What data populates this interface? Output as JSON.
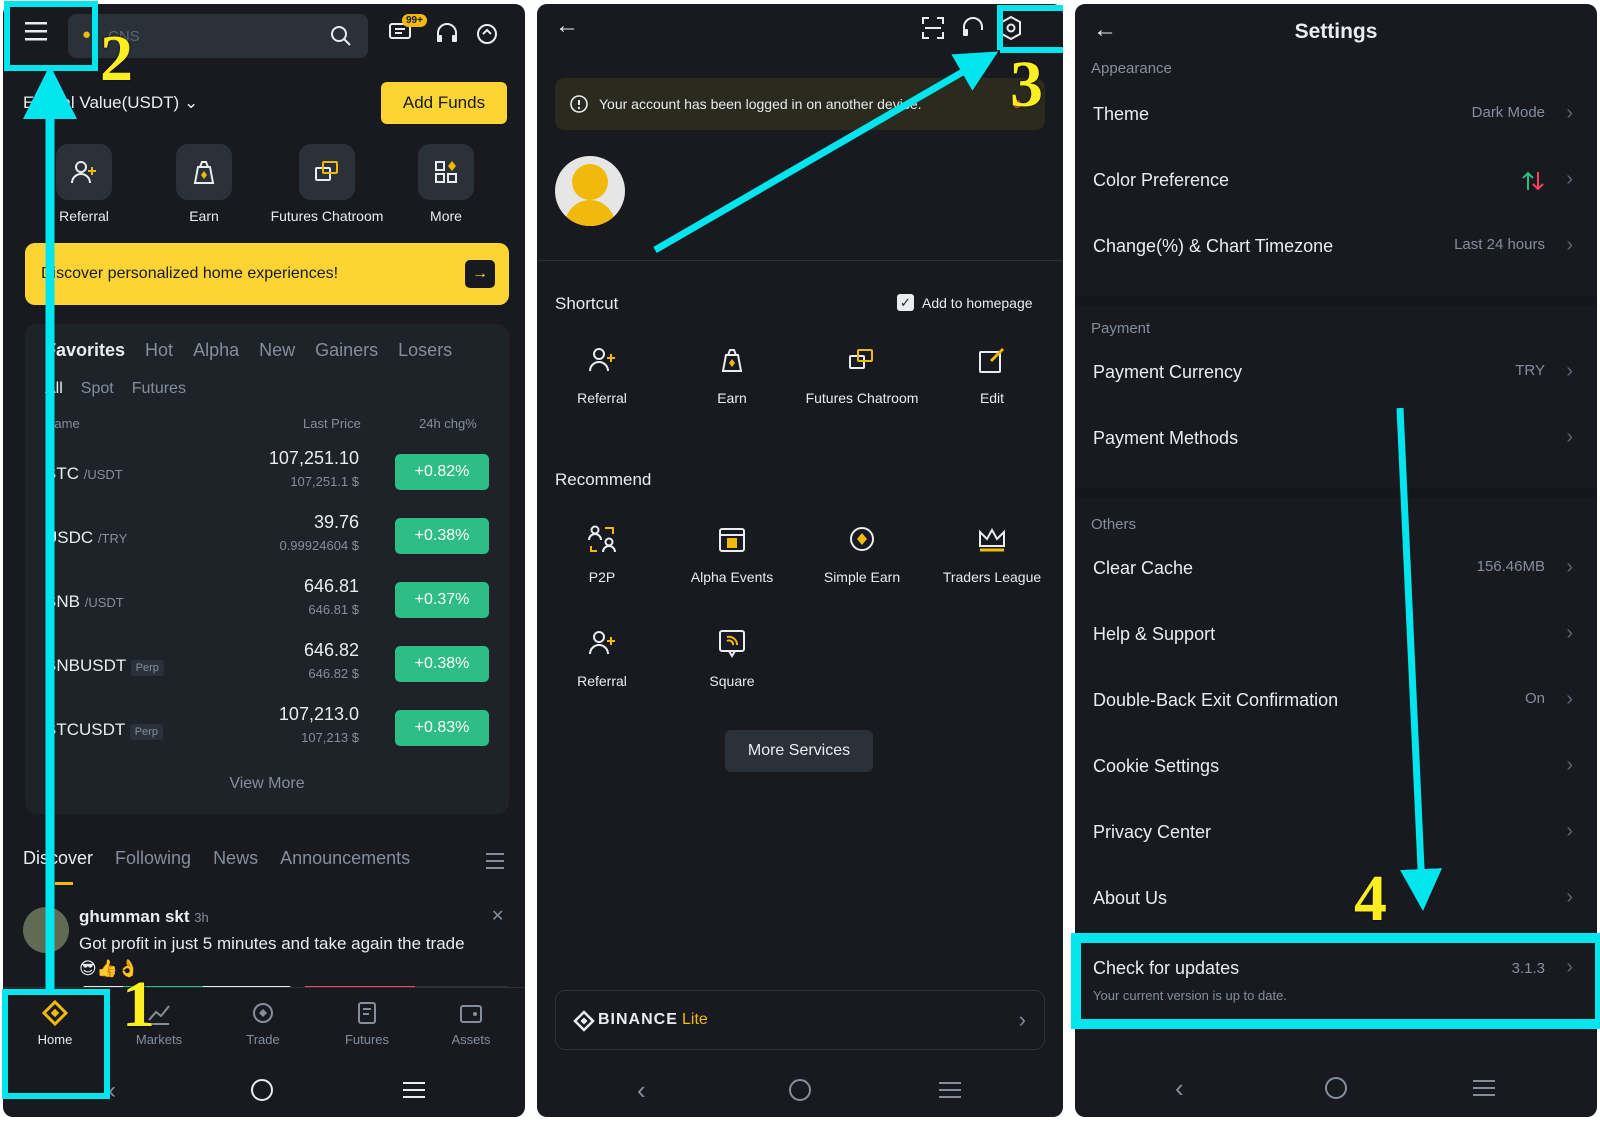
{
  "panel1": {
    "search_placeholder": "CNS",
    "notif_badge": "99+",
    "total_value_label": "Total Value(USDT)",
    "add_funds": "Add Funds",
    "quick_actions": [
      "Referral",
      "Earn",
      "Futures Chatroom",
      "More"
    ],
    "banner_text": "Discover personalized home experiences!",
    "market_tabs": [
      "Favorites",
      "Hot",
      "Alpha",
      "New",
      "Gainers",
      "Losers"
    ],
    "sub_tabs": [
      "All",
      "Spot",
      "Futures"
    ],
    "col_name": "Name",
    "col_last_price": "Last Price",
    "col_chg": "24h chg%",
    "rows": [
      {
        "symbol": "BTC",
        "quote": "/USDT",
        "price": "107,251.10",
        "sub": "107,251.1 $",
        "chg": "+0.82%"
      },
      {
        "symbol": "USDC",
        "quote": "/TRY",
        "price": "39.76",
        "sub": "0.99924604 $",
        "chg": "+0.38%"
      },
      {
        "symbol": "BNB",
        "quote": "/USDT",
        "price": "646.81",
        "sub": "646.81 $",
        "chg": "+0.37%"
      },
      {
        "symbol": "BNBUSDT",
        "quote": "Perp",
        "price": "646.82",
        "sub": "646.82 $",
        "chg": "+0.38%"
      },
      {
        "symbol": "BTCUSDT",
        "quote": "Perp",
        "price": "107,213.0",
        "sub": "107,213 $",
        "chg": "+0.83%"
      }
    ],
    "view_more": "View More",
    "feed_tabs": [
      "Discover",
      "Following",
      "News",
      "Announcements"
    ],
    "post_user": "ghumman skt",
    "post_time": "3h",
    "post_text": "Got profit in just 5 minutes and take again the trade",
    "post_emoji": "😎👍👌",
    "bottom_nav": [
      "Home",
      "Markets",
      "Trade",
      "Futures",
      "Assets"
    ]
  },
  "panel2": {
    "notice": "Your account has been logged in on another device.",
    "shortcut_title": "Shortcut",
    "add_to_homepage": "Add to homepage",
    "shortcuts": [
      "Referral",
      "Earn",
      "Futures Chatroom",
      "Edit"
    ],
    "recommend_title": "Recommend",
    "recommend": [
      "P2P",
      "Alpha Events",
      "Simple Earn",
      "Traders League",
      "Referral",
      "Square"
    ],
    "more_services": "More Services",
    "binance": "BINANCE",
    "lite": "Lite"
  },
  "panel3": {
    "title": "Settings",
    "sec_appearance": "Appearance",
    "theme": "Theme",
    "theme_val": "Dark Mode",
    "color_pref": "Color Preference",
    "change_tz": "Change(%) & Chart Timezone",
    "change_tz_val": "Last 24 hours",
    "sec_payment": "Payment",
    "pay_currency": "Payment Currency",
    "pay_currency_val": "TRY",
    "pay_methods": "Payment Methods",
    "sec_others": "Others",
    "clear_cache": "Clear Cache",
    "clear_cache_val": "156.46MB",
    "help": "Help & Support",
    "double_back": "Double-Back Exit Confirmation",
    "double_back_val": "On",
    "cookie": "Cookie Settings",
    "privacy": "Privacy Center",
    "about": "About Us",
    "check_updates": "Check for updates",
    "version": "3.1.3",
    "update_note": "Your current version is up to date."
  },
  "annotations": {
    "step1": "1",
    "step2": "2",
    "step3": "3",
    "step4": "4"
  },
  "colors": {
    "accent": "#fcd535",
    "highlight": "#00e5ee",
    "up": "#2ebd85",
    "bg": "#181a20"
  }
}
